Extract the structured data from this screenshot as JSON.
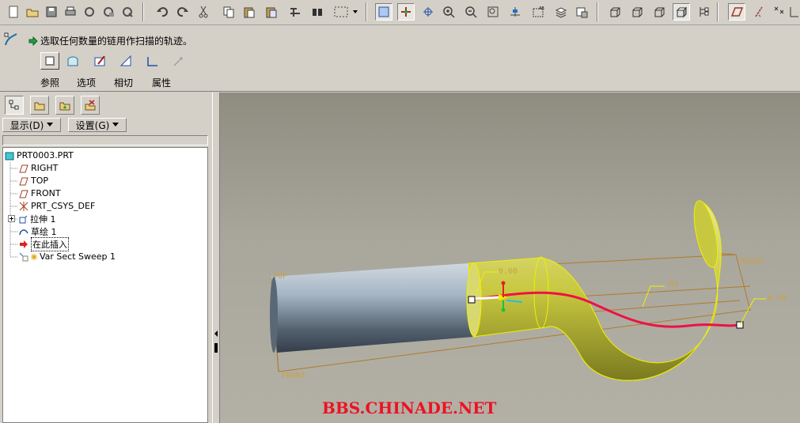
{
  "prompt": {
    "text": "选取任何数量的链用作扫描的轨迹。"
  },
  "dashboard": {
    "tabs": [
      {
        "label": "参照"
      },
      {
        "label": "选项"
      },
      {
        "label": "相切"
      },
      {
        "label": "属性"
      }
    ]
  },
  "panel": {
    "display_menu": "显示(D)",
    "settings_menu": "设置(G)"
  },
  "tree": {
    "items": [
      {
        "label": "PRT0003.PRT"
      },
      {
        "label": "RIGHT"
      },
      {
        "label": "TOP"
      },
      {
        "label": "FRONT"
      },
      {
        "label": "PRT_CSYS_DEF"
      },
      {
        "label": "拉伸 1"
      },
      {
        "label": "草绘 1"
      },
      {
        "label": "在此插入"
      },
      {
        "label": "Var Sect Sweep 1"
      }
    ]
  },
  "viewport": {
    "datum_top": "TOP",
    "datum_right": "RIGHT",
    "datum_front": "FRONT",
    "origin_label": "RA",
    "dim_start": "0.00",
    "dim_end": "0.00",
    "watermark": "BBS.CHINADE.NET"
  },
  "colors": {
    "trajectory": "#ee1144",
    "sweep_surface": "#c8c840",
    "watermark": "#ee1122",
    "datum": "#b07a2a"
  }
}
